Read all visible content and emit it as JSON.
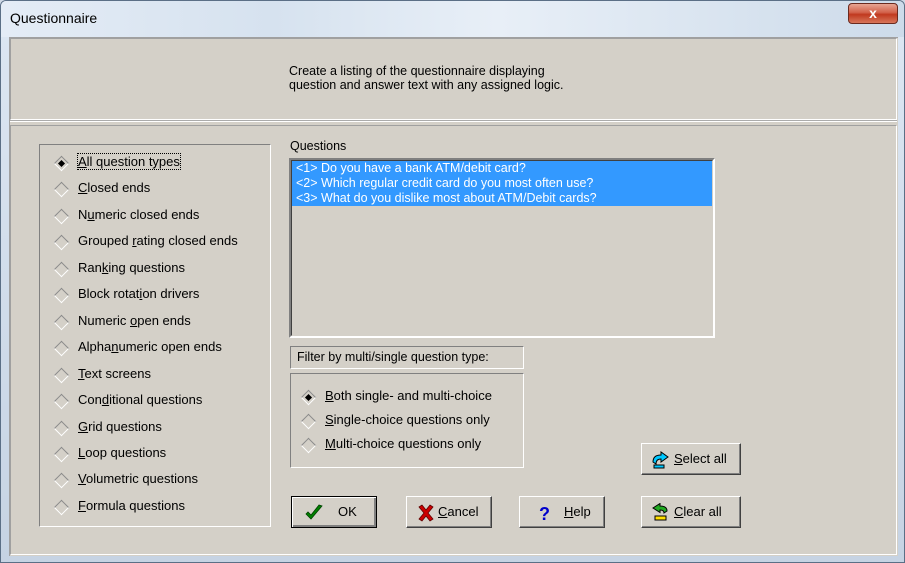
{
  "window": {
    "title": "Questionnaire",
    "close": "x"
  },
  "description": {
    "line1": "Create a listing of the questionnaire displaying",
    "line2": "question and answer text with any assigned logic."
  },
  "question_types": [
    {
      "pre": "",
      "u": "A",
      "post": "ll question types",
      "selected": true
    },
    {
      "pre": "",
      "u": "C",
      "post": "losed ends",
      "selected": false
    },
    {
      "pre": "N",
      "u": "u",
      "post": "meric closed ends",
      "selected": false
    },
    {
      "pre": "Grouped ",
      "u": "r",
      "post": "ating closed ends",
      "selected": false
    },
    {
      "pre": "Ran",
      "u": "k",
      "post": "ing questions",
      "selected": false
    },
    {
      "pre": "Block rotat",
      "u": "i",
      "post": "on drivers",
      "selected": false
    },
    {
      "pre": "Numeric ",
      "u": "o",
      "post": "pen ends",
      "selected": false
    },
    {
      "pre": "Alpha",
      "u": "n",
      "post": "umeric open ends",
      "selected": false
    },
    {
      "pre": "",
      "u": "T",
      "post": "ext screens",
      "selected": false
    },
    {
      "pre": "Con",
      "u": "d",
      "post": "itional questions",
      "selected": false
    },
    {
      "pre": "",
      "u": "G",
      "post": "rid questions",
      "selected": false
    },
    {
      "pre": "",
      "u": "L",
      "post": "oop questions",
      "selected": false
    },
    {
      "pre": "",
      "u": "V",
      "post": "olumetric questions",
      "selected": false
    },
    {
      "pre": "",
      "u": "F",
      "post": "ormula questions",
      "selected": false
    }
  ],
  "questions": {
    "label": "Questions",
    "items": [
      "<1>  Do you have a bank ATM/debit card?",
      "<2>  Which regular credit card do you most often use?",
      "<3>  What do you dislike most about ATM/Debit cards?"
    ]
  },
  "filter": {
    "label": "Filter by multi/single question type:",
    "options": [
      {
        "pre": "",
        "u": "B",
        "post": "oth single- and multi-choice",
        "selected": true
      },
      {
        "pre": "",
        "u": "S",
        "post": "ingle-choice questions only",
        "selected": false
      },
      {
        "pre": "",
        "u": "M",
        "post": "ulti-choice questions only",
        "selected": false
      }
    ]
  },
  "buttons": {
    "ok": "OK",
    "cancel": {
      "u": "C",
      "post": "ancel"
    },
    "help": {
      "u": "H",
      "post": "elp"
    },
    "select_all": {
      "u": "S",
      "post": "elect all"
    },
    "clear_all": {
      "u": "C",
      "post": "lear all"
    }
  },
  "colors": {
    "selection": "#3399ff",
    "dialog_face": "#d4d0c8",
    "close_red": "#c0391f"
  },
  "icons": [
    "close-icon",
    "checkmark-icon",
    "x-mark-icon",
    "question-mark-icon",
    "select-arrow-icon",
    "clear-arrow-icon"
  ]
}
